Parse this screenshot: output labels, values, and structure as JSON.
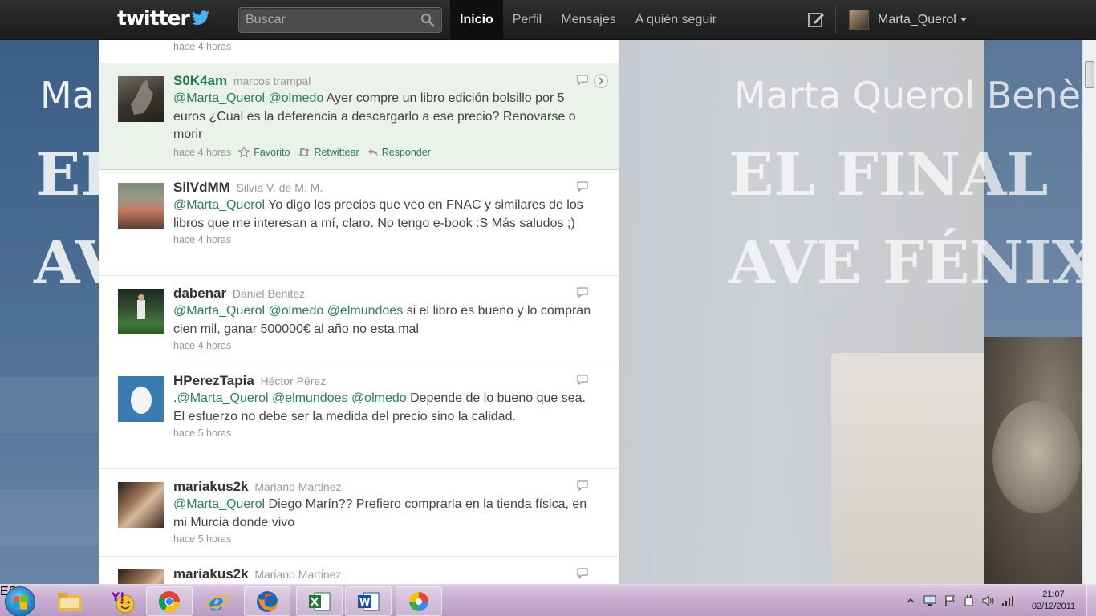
{
  "background": {
    "author": "Marta Querol Benèch",
    "author_left": "Ma",
    "title_line1": "EL FINAL",
    "title_line2": "AVE FÉNIX",
    "title_line1_left": "EL",
    "title_line2_left": "AV",
    "title_line2_right": "AVE FÉNIX"
  },
  "topbar": {
    "logo": "twitter",
    "search_placeholder": "Buscar",
    "nav": [
      {
        "label": "Inicio",
        "active": true
      },
      {
        "label": "Perfil"
      },
      {
        "label": "Mensajes"
      },
      {
        "label": "A quién seguir"
      }
    ],
    "username": "Marta_Querol"
  },
  "timeline": {
    "top_time": "hace 4 horas",
    "tweets": [
      {
        "screen_name": "S0K4am",
        "full_name": "marcos trampal",
        "mentions": [
          "@Marta_Querol",
          "@olmedo"
        ],
        "text": " Ayer compre un libro edición bolsillo por 5 euros ¿Cual es la deferencia a descargarlo a ese precio? Renovarse o morir",
        "time": "hace 4 horas",
        "actions": {
          "favorite": "Favorito",
          "retweet": "Retwittear",
          "reply": "Responder"
        }
      },
      {
        "screen_name": "SilVdMM",
        "full_name": "Silvia V. de M. M.",
        "mentions": [
          "@Marta_Querol"
        ],
        "text": " Yo digo los precios que veo en FNAC y similares de los libros que me interesan a mí, claro. No tengo e-book :S Más saludos ;)",
        "time": "hace 4 horas"
      },
      {
        "screen_name": "dabenar",
        "full_name": "Daniel Benitez",
        "mentions": [
          "@Marta_Querol",
          "@olmedo",
          "@elmundoes"
        ],
        "text": " si el libro es bueno y lo compran cien mil, ganar 500000€ al año no esta mal",
        "time": "hace 4 horas"
      },
      {
        "screen_name": "HPerezTapia",
        "full_name": "Héctor Pérez",
        "prefix": ".",
        "mentions": [
          "@Marta_Querol",
          "@elmundoes",
          "@olmedo"
        ],
        "text": " Depende de lo bueno que sea. El esfuerzo no debe ser la medida del precio sino la calidad.",
        "time": "hace 5 horas"
      },
      {
        "screen_name": "mariakus2k",
        "full_name": "Mariano Martinez",
        "mentions": [
          "@Marta_Querol"
        ],
        "text": " Diego Marín?? Prefiero comprarla en la tienda física, en mi Murcia donde vivo",
        "time": "hace 5 horas"
      },
      {
        "screen_name": "mariakus2k",
        "full_name": "Mariano Martinez"
      }
    ]
  },
  "taskbar": {
    "language": "ES",
    "time": "21:07",
    "date": "02/12/2011",
    "apps": [
      "windows-explorer-icon",
      "yahoo-messenger-icon",
      "chrome-icon",
      "internet-explorer-icon",
      "firefox-icon",
      "excel-icon",
      "word-icon",
      "picasa-icon"
    ]
  },
  "colors": {
    "mention": "#2a8060",
    "highlight_bg": "#eaf2ea",
    "topbar": "#1c1c1c"
  }
}
